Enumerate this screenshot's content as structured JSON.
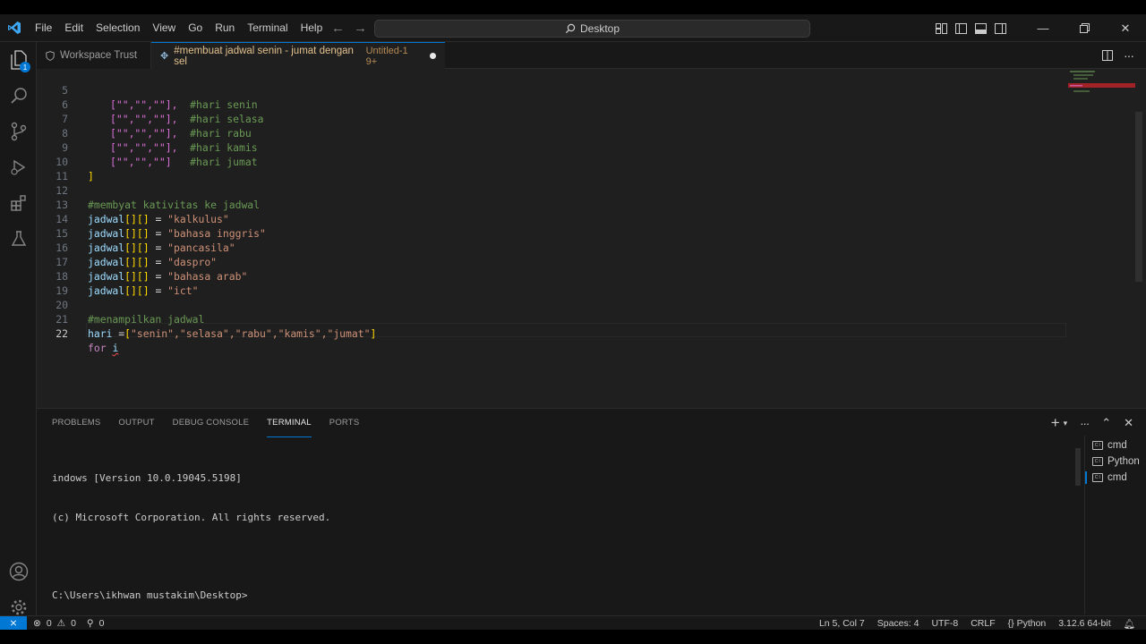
{
  "menu": [
    "File",
    "Edit",
    "Selection",
    "View",
    "Go",
    "Run",
    "Terminal",
    "Help"
  ],
  "search": {
    "text": "Desktop"
  },
  "activity_badge": "1",
  "tabs": {
    "trust_label": "Workspace Trust",
    "active_label": "#membuat jadwal senin - jumat dengan sel",
    "active_sub": "Untitled-1 9+"
  },
  "editor": {
    "line_numbers": [
      "5",
      "6",
      "7",
      "8",
      "9",
      "10",
      "11",
      "12",
      "13",
      "14",
      "15",
      "16",
      "17",
      "18",
      "19",
      "20",
      "21",
      "22"
    ],
    "lines": {
      "l5_arr": "[\"\",\"\",\"\"],",
      "l5_cm": "#hari senin",
      "l6_arr": "[\"\",\"\",\"\"],",
      "l6_cm": "#hari selasa",
      "l7_arr": "[\"\",\"\",\"\"],",
      "l7_cm": "#hari rabu",
      "l8_arr": "[\"\",\"\",\"\"],",
      "l8_cm": "#hari kamis",
      "l9_arr": "[\"\",\"\",\"\"]",
      "l9_cm": "#hari jumat",
      "l10": "]",
      "l12": "#membyat kativitas ke jadwal",
      "jadwal_var": "jadwal",
      "idx": "[][]",
      "eq": " = ",
      "l13_str": "\"kalkulus\"",
      "l14_str": "\"bahasa inggris\"",
      "l15_str": "\"pancasila\"",
      "l16_str": "\"daspro\"",
      "l17_str": "\"bahasa arab\"",
      "l18_str": "\"ict\"",
      "l20": "#menampilkan jadwal",
      "l21_var": "hari",
      "l21_eq": " =",
      "l21_open": "[",
      "l21_items": "\"senin\",\"selasa\",\"rabu\",\"kamis\",\"jumat\"",
      "l21_close": "]",
      "l22_kw": "for",
      "l22_var": "i"
    }
  },
  "panel": {
    "tabs": [
      "PROBLEMS",
      "OUTPUT",
      "DEBUG CONSOLE",
      "TERMINAL",
      "PORTS"
    ],
    "active_tab": "TERMINAL",
    "terminal_lines": [
      "indows [Version 10.0.19045.5198]",
      "(c) Microsoft Corporation. All rights reserved.",
      "",
      "C:\\Users\\ikhwan mustakim\\Desktop>"
    ],
    "terminal_list": [
      "cmd",
      "Python",
      "cmd"
    ]
  },
  "status": {
    "errors": "0",
    "warnings": "0",
    "ports": "0",
    "position": "Ln 5, Col 7",
    "spaces": "Spaces: 4",
    "encoding": "UTF-8",
    "eol": "CRLF",
    "language": "Python",
    "interpreter": "3.12.6 64-bit"
  },
  "colors": {
    "accent": "#0078d4",
    "editor_bg": "#1f1f1f",
    "chrome_bg": "#181818",
    "string": "#ce9178",
    "comment": "#6a9955",
    "variable": "#9cdcfe",
    "keyword": "#c586c0"
  }
}
